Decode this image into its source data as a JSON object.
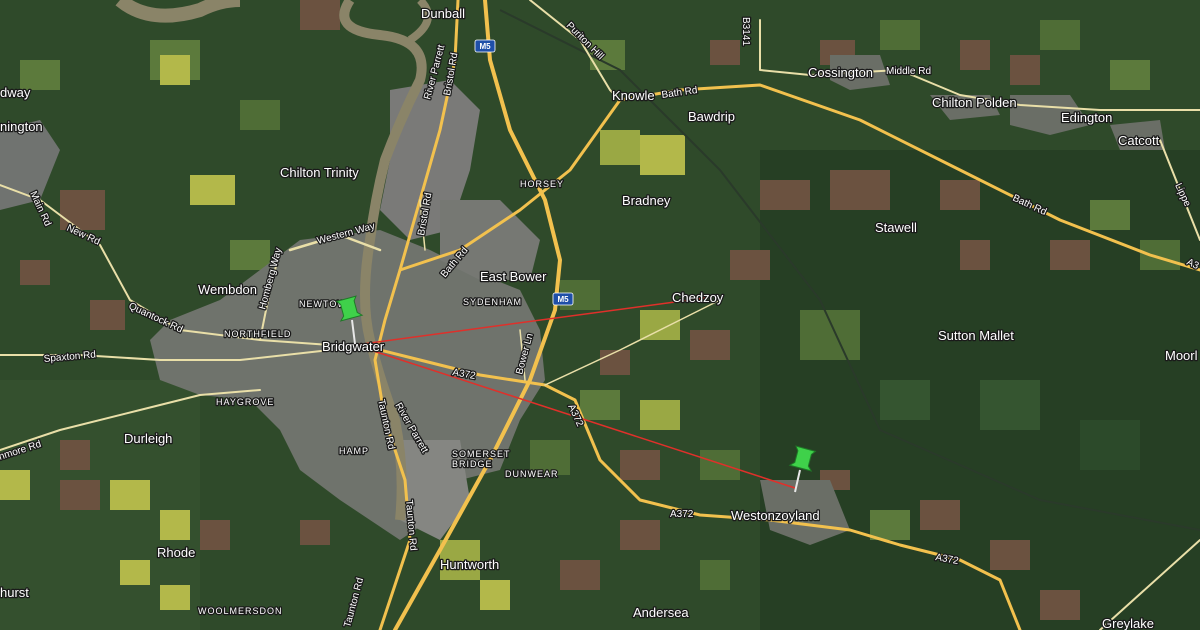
{
  "map": {
    "type": "satellite",
    "colors": {
      "base": "#2f4a2a",
      "field_light": "#5c7a3c",
      "field_yellow": "#b3b84a",
      "field_brown": "#6b5240",
      "urban": "#7a7a78",
      "river": "#8a8468",
      "road_major": "#f2c14e",
      "road_minor": "#e9dfa8",
      "measure_line": "#e0302a",
      "pin": "#3fd14a"
    }
  },
  "labels": {
    "dunball": "Dunball",
    "puriton_hill": "Puriton Hill",
    "b3141": "B3141",
    "cossington": "Cossington",
    "middle_rd": "Middle Rd",
    "knowle": "Knowle",
    "bath_rd_1": "Bath Rd",
    "bawdrip": "Bawdrip",
    "chilton_polden": "Chilton Polden",
    "edington": "Edington",
    "catcott": "Catcott",
    "lippiatt": "Lippe",
    "dway": "dway",
    "nington": "nington",
    "chilton_trinity": "Chilton Trinity",
    "horsey": "HORSEY",
    "bradney": "Bradney",
    "bath_rd_2": "Bath Rd",
    "stawell": "Stawell",
    "a3_edge": "A3",
    "main_rd": "Main Rd",
    "new_rd": "New Rd",
    "western_way": "Western Way",
    "bristol_rd_1": "Bristol Rd",
    "bristol_rd_2": "Bristol Rd",
    "river_parrett_1": "River Parrett",
    "bath_rd_3": "Bath Rd",
    "hornberg_way": "Homberg Way",
    "wembdon": "Wembdon",
    "east_bower": "East Bower",
    "newtown": "NEWTOWN",
    "sydenham": "SYDENHAM",
    "chedzoy": "Chedzoy",
    "quantock_rd": "Quantock Rd",
    "northfield": "NORTHFIELD",
    "bridgwater": "Bridgwater",
    "sutton_mallet": "Sutton Mallet",
    "moor": "Moorl",
    "spaxton_rd": "Spaxton Rd",
    "a372_1": "A372",
    "bower_ln": "Bower Ln",
    "haygrove": "HAYGROVE",
    "a372_2": "A372",
    "durleigh": "Durleigh",
    "nmore_rd": "nmore Rd",
    "taunton_rd_1": "Taunton Rd",
    "river_parrett_2": "River Parrett",
    "hamp": "HAMP",
    "somerset_bridge_1": "SOMERSET",
    "somerset_bridge_2": "BRIDGE",
    "dunwear": "DUNWEAR",
    "a372_3": "A372",
    "westonzoyland": "Westonzoyland",
    "taunton_rd_2": "Taunton Rd",
    "a372_4": "A372",
    "rhode": "Rhode",
    "huntworth": "Huntworth",
    "hurst": "hurst",
    "woolmersdon": "WOOLMERSDON",
    "taunton_rd_3": "Taunton Rd",
    "andersea": "Andersea",
    "greylake": "Greylake"
  },
  "shields": {
    "m5_top": "M5",
    "m5_mid": "M5"
  },
  "markers": [
    {
      "name": "Bridgwater pin",
      "icon": "pushpin-icon"
    },
    {
      "name": "Westonzoyland pin",
      "icon": "pushpin-icon"
    }
  ]
}
